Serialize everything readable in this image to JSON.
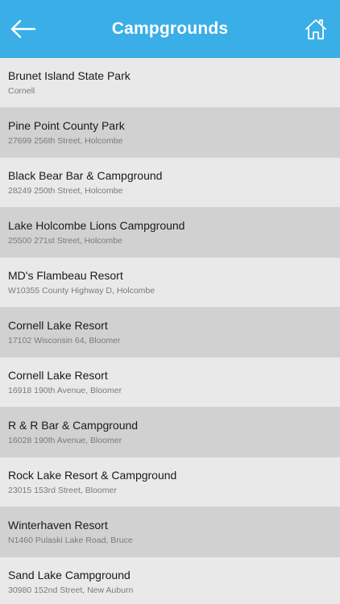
{
  "header": {
    "title": "Campgrounds",
    "back_icon": "arrow-left-icon",
    "home_icon": "home-icon",
    "color": "#3aaee6"
  },
  "campgrounds": [
    {
      "name": "Brunet Island State Park",
      "address": "Cornell"
    },
    {
      "name": "Pine Point County Park",
      "address": "27699 256th Street, Holcombe"
    },
    {
      "name": "Black Bear Bar & Campground",
      "address": "28249 250th Street, Holcombe"
    },
    {
      "name": "Lake Holcombe Lions Campground",
      "address": "25500 271st Street, Holcombe"
    },
    {
      "name": "MD's Flambeau Resort",
      "address": "W10355 County Highway D, Holcombe"
    },
    {
      "name": "Cornell Lake Resort",
      "address": "17102 Wisconsin 64, Bloomer"
    },
    {
      "name": "Cornell Lake Resort",
      "address": "16918 190th Avenue, Bloomer"
    },
    {
      "name": "R & R Bar & Campground",
      "address": "16028 190th Avenue, Bloomer"
    },
    {
      "name": "Rock Lake Resort & Campground",
      "address": "23015 153rd Street, Bloomer"
    },
    {
      "name": "Winterhaven Resort",
      "address": "N1460 Pulaski Lake Road, Bruce"
    },
    {
      "name": "Sand Lake Campground",
      "address": "30980 152nd Street, New Auburn"
    }
  ]
}
